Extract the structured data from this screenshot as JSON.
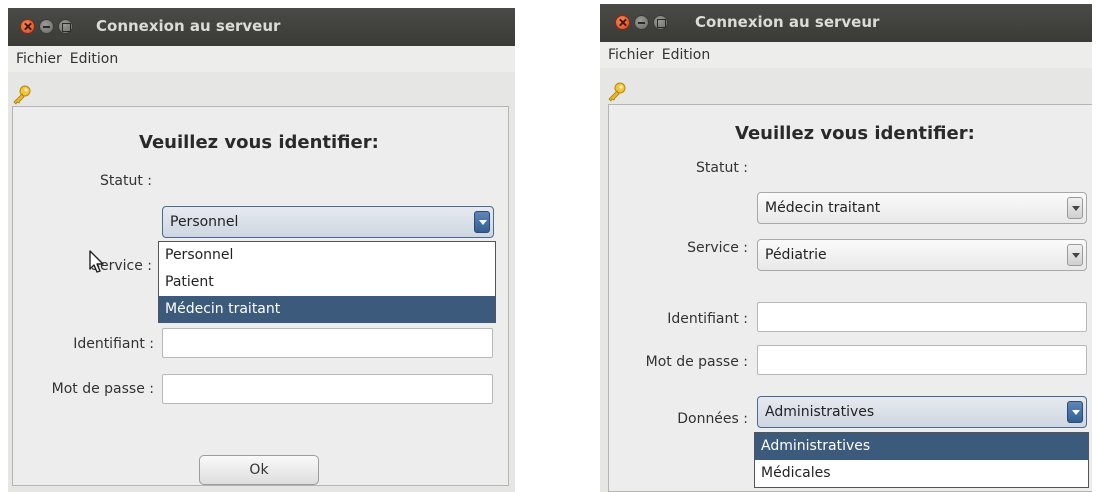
{
  "left_window": {
    "title": "Connexion au serveur",
    "menu": [
      "Fichier",
      "Edition"
    ],
    "heading": "Veuillez vous identifier:",
    "statut_label": "Statut :",
    "statut_value": "Personnel",
    "statut_options": [
      "Personnel",
      "Patient",
      "Médecin traitant"
    ],
    "statut_highlighted": "Médecin traitant",
    "service_label": "Service :",
    "identifiant_label": "Identifiant :",
    "identifiant_value": "",
    "motdepasse_label": "Mot de passe :",
    "motdepasse_value": "",
    "ok_label": "Ok"
  },
  "right_window": {
    "title": "Connexion au serveur",
    "menu": [
      "Fichier",
      "Edition"
    ],
    "heading": "Veuillez vous identifier:",
    "statut_label": "Statut :",
    "statut_value": "Médecin traitant",
    "service_label": "Service :",
    "service_value": "Pédiatrie",
    "identifiant_label": "Identifiant :",
    "identifiant_value": "",
    "motdepasse_label": "Mot de passe :",
    "motdepasse_value": "",
    "donnees_label": "Données :",
    "donnees_value": "Administratives",
    "donnees_options": [
      "Administratives",
      "Médicales"
    ],
    "donnees_highlighted": "Administratives"
  },
  "colors": {
    "titlebar": "#3e3e3b",
    "title_text": "#dcdcd6",
    "close_button": "#e05a2b",
    "selection": "#3c5a7c",
    "window_bg": "#e6e6e4"
  },
  "icons": [
    "close-icon",
    "minimize-icon",
    "maximize-icon",
    "key-icon",
    "mouse-cursor-icon",
    "chevron-down-icon"
  ]
}
